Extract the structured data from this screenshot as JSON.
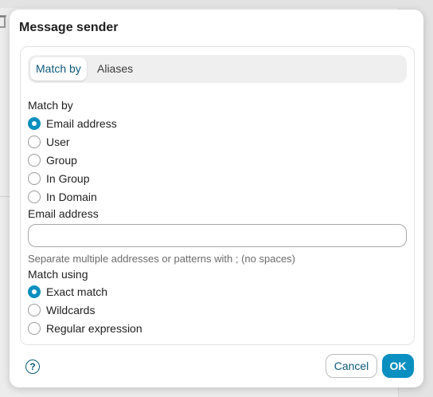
{
  "dialog": {
    "title": "Message sender",
    "help_icon": "question-circle-icon",
    "cancel_label": "Cancel",
    "ok_label": "OK"
  },
  "tabs": [
    {
      "label": "Match by",
      "active": true
    },
    {
      "label": "Aliases",
      "active": false
    }
  ],
  "match_by": {
    "label": "Match by",
    "options": [
      {
        "label": "Email address",
        "checked": true
      },
      {
        "label": "User",
        "checked": false
      },
      {
        "label": "Group",
        "checked": false
      },
      {
        "label": "In Group",
        "checked": false
      },
      {
        "label": "In Domain",
        "checked": false
      }
    ]
  },
  "email_address": {
    "label": "Email address",
    "value": "",
    "hint": "Separate multiple addresses or patterns with ; (no spaces)"
  },
  "match_using": {
    "label": "Match using",
    "options": [
      {
        "label": "Exact match",
        "checked": true
      },
      {
        "label": "Wildcards",
        "checked": false
      },
      {
        "label": "Regular expression",
        "checked": false
      }
    ]
  },
  "colors": {
    "accent": "#0a8fc0",
    "accent_text": "#0d5a7a"
  },
  "background": {
    "trash_icon": "trash-icon"
  }
}
